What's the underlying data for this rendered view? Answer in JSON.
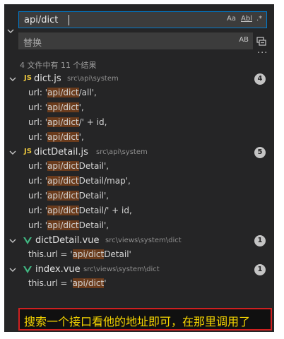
{
  "search": {
    "value": "api/dict",
    "case_label": "Aa",
    "word_label": "Abl",
    "regex_label": ".*"
  },
  "replace": {
    "placeholder": "替换",
    "preserve_case_label": "AB"
  },
  "summary": "4 文件中有 11 个结果",
  "files": [
    {
      "icon": "js",
      "name": "dict.js",
      "path": "src\\api\\system",
      "count": "4",
      "matches": [
        {
          "pre": "url: '",
          "hit": "api/dict",
          "post": "/all',"
        },
        {
          "pre": "url: '",
          "hit": "api/dict",
          "post": "',"
        },
        {
          "pre": "url: '",
          "hit": "api/dict",
          "post": "/' + id,"
        },
        {
          "pre": "url: '",
          "hit": "api/dict",
          "post": "',"
        }
      ]
    },
    {
      "icon": "js",
      "name": "dictDetail.js",
      "path": "src\\api\\system",
      "count": "5",
      "matches": [
        {
          "pre": "url: '",
          "hit": "api/dict",
          "post": "Detail',"
        },
        {
          "pre": "url: '",
          "hit": "api/dict",
          "post": "Detail/map',"
        },
        {
          "pre": "url: '",
          "hit": "api/dict",
          "post": "Detail',"
        },
        {
          "pre": "url: '",
          "hit": "api/dict",
          "post": "Detail/' + id,"
        },
        {
          "pre": "url: '",
          "hit": "api/dict",
          "post": "Detail',"
        }
      ]
    },
    {
      "icon": "vue",
      "name": "dictDetail.vue",
      "path": "src\\views\\system\\dict",
      "count": "1",
      "matches": [
        {
          "pre": "this.url = '",
          "hit": "api/dict",
          "post": "Detail'"
        }
      ]
    },
    {
      "icon": "vue",
      "name": "index.vue",
      "path": "src\\views\\system\\dict",
      "count": "1",
      "matches": [
        {
          "pre": "this.url = '",
          "hit": "api/dict",
          "post": "'"
        }
      ]
    }
  ],
  "banner": "搜索一个接口看他的地址即可，在那里调用了",
  "colors": {
    "accent": "#007acc",
    "match_highlight": "#6a3b1c",
    "js_icon": "#e8c33d",
    "vue_icon": "#41b883",
    "banner_text": "#f5d400",
    "banner_border": "#d02020"
  }
}
